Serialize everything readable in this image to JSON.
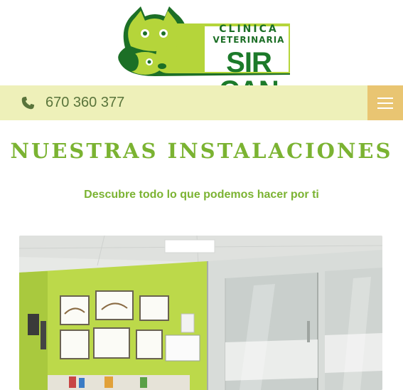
{
  "logo": {
    "line1": "CLINICA",
    "line2": "VETERINARIA",
    "line3": "SIR CAN",
    "icon": "cat-dog-logo-icon"
  },
  "topbar": {
    "phone_icon": "phone-icon",
    "phone_number": "670 360 377",
    "menu_icon": "hamburger-menu-icon"
  },
  "main": {
    "title": "NUESTRAS INSTALACIONES",
    "subtitle": "Descubre todo lo que podemos hacer por ti"
  },
  "colors": {
    "accent_green": "#7bb332",
    "topbar_bg": "#eef0b9",
    "menu_bg": "#e9c572",
    "logo_green": "#1c6f26"
  }
}
